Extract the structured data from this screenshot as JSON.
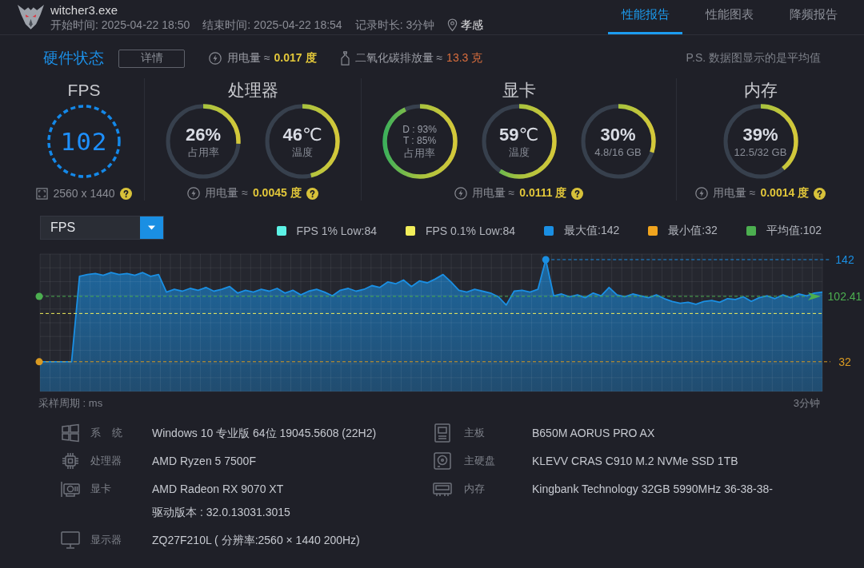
{
  "header": {
    "title": "witcher3.exe",
    "meta": [
      "开始时间: 2025-04-22 18:50",
      "结束时间: 2025-04-22 18:54",
      "记录时长: 3分钟"
    ],
    "location": "孝感"
  },
  "tabs": [
    {
      "label": "性能报告",
      "selected": true
    },
    {
      "label": "性能图表",
      "selected": false
    },
    {
      "label": "降频报告",
      "selected": false
    }
  ],
  "summary": {
    "title": "硬件状态",
    "button": "详情",
    "stats": [
      {
        "kind": "power",
        "label": "用电量 ≈",
        "value": "0.017 度"
      },
      {
        "kind": "carbon",
        "label": "二氧化碳排放量 ≈",
        "value": "13.3 克"
      }
    ],
    "note": "P.S. 数据图显示的是平均值"
  },
  "sections": [
    {
      "kind": "fps",
      "title": "FPS",
      "display": "102",
      "resolution": "2560 x 1440"
    },
    {
      "kind": "gauges",
      "title": "处理器",
      "gauges": [
        {
          "kind": "single",
          "value": "26%",
          "caption": "占用率",
          "level": 0.26
        },
        {
          "kind": "single",
          "value": "46",
          "unit": "℃",
          "caption": "温度",
          "level": 0.46
        }
      ],
      "power": {
        "label": "用电量 ≈",
        "value": "0.0045 度"
      }
    },
    {
      "kind": "gauges",
      "title": "显卡",
      "gauges": [
        {
          "kind": "dual",
          "lines": [
            "D : 93%",
            "T : 85%"
          ],
          "caption": "占用率",
          "level": 0.93
        },
        {
          "kind": "single",
          "value": "59",
          "unit": "℃",
          "caption": "温度",
          "level": 0.59
        },
        {
          "kind": "single",
          "value": "30%",
          "caption": "4.8/16 GB",
          "level": 0.3
        }
      ],
      "power": {
        "label": "用电量 ≈",
        "value": "0.0111 度"
      }
    },
    {
      "kind": "gauges",
      "title": "内存",
      "gauges": [
        {
          "kind": "single",
          "value": "39%",
          "caption": "12.5/32 GB",
          "level": 0.39
        }
      ],
      "power": {
        "label": "用电量 ≈",
        "value": "0.0014 度"
      }
    }
  ],
  "chart": {
    "selector": "FPS",
    "legend": [
      {
        "label": "FPS 1% Low:84",
        "color": "#5cf2e6"
      },
      {
        "label": "FPS 0.1% Low:84",
        "color": "#f2ee5a"
      },
      {
        "label": "最大值:142",
        "color": "#1a8fe3"
      },
      {
        "label": "最小值:32",
        "color": "#f0a41e"
      },
      {
        "label": "平均值:102",
        "color": "#4caf50"
      }
    ],
    "chart_data": {
      "type": "area",
      "xlabel": "采样周期 : ms",
      "categories": [
        null,
        null,
        null,
        null,
        null,
        null,
        null,
        null,
        null,
        null,
        null,
        null,
        null,
        null,
        null,
        null,
        null,
        null,
        null,
        null,
        null,
        null,
        null,
        null,
        null,
        null,
        null,
        null,
        null,
        null,
        null,
        null,
        null,
        null,
        null,
        null,
        null,
        null,
        null,
        null,
        null,
        null,
        null,
        null,
        null,
        null,
        null,
        null,
        null,
        null,
        null,
        null,
        null,
        null,
        null,
        null,
        null,
        null,
        null,
        null,
        null,
        null,
        null,
        null,
        null,
        null,
        null,
        null,
        null,
        null,
        null,
        null,
        null,
        null,
        null,
        null,
        null,
        null,
        null,
        null,
        null,
        null,
        null,
        null,
        null,
        null,
        null,
        null,
        null,
        null,
        null,
        null,
        null,
        null,
        null,
        null,
        null,
        "3分钟",
        null,
        null
      ],
      "ylim": [
        0,
        148
      ],
      "yticks": [
        32,
        102.41,
        142
      ],
      "grid": true,
      "series": [
        {
          "color": "#1a8fe3",
          "values": [
            32,
            32,
            32,
            32,
            32,
            124,
            126,
            127,
            125,
            128,
            126,
            127,
            125,
            128,
            124,
            126,
            107,
            110,
            108,
            111,
            109,
            112,
            108,
            110,
            113,
            106,
            109,
            107,
            110,
            108,
            111,
            106,
            109,
            104,
            108,
            110,
            107,
            103,
            109,
            111,
            108,
            110,
            114,
            112,
            118,
            116,
            120,
            113,
            119,
            117,
            121,
            126,
            118,
            109,
            107,
            110,
            108,
            106,
            102,
            93,
            108,
            109,
            107,
            110,
            142,
            103,
            105,
            102,
            104,
            101,
            106,
            103,
            112,
            104,
            102,
            105,
            103,
            101,
            104,
            100,
            97,
            95,
            96,
            94,
            97,
            98,
            96,
            100,
            99,
            102,
            97,
            101,
            103,
            100,
            104,
            101,
            105,
            103,
            106,
            107
          ]
        }
      ],
      "ref_lines": [
        {
          "axis": "y",
          "value": 142,
          "color": "#1a8fe3"
        },
        {
          "axis": "y",
          "value": 102.41,
          "color": "#4caf50"
        },
        {
          "axis": "y",
          "value": 84,
          "color": "#f2ee5a"
        },
        {
          "axis": "y",
          "value": 32,
          "color": "#d99a22"
        }
      ]
    }
  },
  "info": {
    "left": [
      {
        "kind": "system",
        "label": "系 统",
        "values": [
          "Windows 10 专业版 64位 19045.5608 (22H2)"
        ]
      },
      {
        "kind": "cpu",
        "label": "处理器",
        "values": [
          "AMD Ryzen 5 7500F"
        ]
      },
      {
        "kind": "gpu",
        "label": "显卡",
        "values": [
          "AMD Radeon RX 9070 XT",
          "驱动版本 : 32.0.13031.3015"
        ]
      },
      {
        "kind": "display",
        "label": "显示器",
        "values": [
          "ZQ27F210L ( 分辨率:2560 × 1440 200Hz)"
        ]
      }
    ],
    "right": [
      {
        "kind": "board",
        "label": "主板",
        "values": [
          "B650M AORUS PRO AX"
        ]
      },
      {
        "kind": "disk",
        "label": "主硬盘",
        "values": [
          "KLEVV CRAS C910 M.2 NVMe SSD 1TB"
        ]
      },
      {
        "kind": "memory",
        "label": "内存",
        "values": [
          "Kingbank Technology 32GB 5990MHz 36-38-38-"
        ]
      }
    ]
  }
}
